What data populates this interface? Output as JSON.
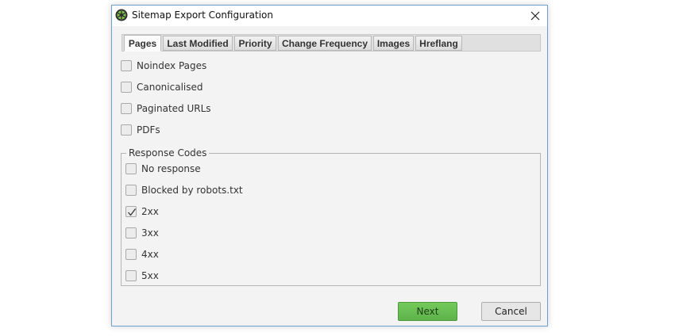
{
  "window": {
    "title": "Sitemap Export Configuration"
  },
  "tabs": [
    {
      "label": "Pages",
      "active": true
    },
    {
      "label": "Last Modified",
      "active": false
    },
    {
      "label": "Priority",
      "active": false
    },
    {
      "label": "Change Frequency",
      "active": false
    },
    {
      "label": "Images",
      "active": false
    },
    {
      "label": "Hreflang",
      "active": false
    }
  ],
  "options": [
    {
      "label": "Noindex Pages",
      "checked": false
    },
    {
      "label": "Canonicalised",
      "checked": false
    },
    {
      "label": "Paginated URLs",
      "checked": false
    },
    {
      "label": "PDFs",
      "checked": false
    }
  ],
  "response_codes": {
    "legend": "Response Codes",
    "items": [
      {
        "label": "No response",
        "checked": false
      },
      {
        "label": "Blocked by robots.txt",
        "checked": false
      },
      {
        "label": "2xx",
        "checked": true
      },
      {
        "label": "3xx",
        "checked": false
      },
      {
        "label": "4xx",
        "checked": false
      },
      {
        "label": "5xx",
        "checked": false
      }
    ]
  },
  "buttons": {
    "next_label": "Next",
    "cancel_label": "Cancel"
  },
  "colors": {
    "accent_green": "#6abf52",
    "window_border": "#6f9fd0"
  },
  "icons": {
    "app": "spider-icon",
    "close": "close-icon",
    "check": "check-icon"
  }
}
